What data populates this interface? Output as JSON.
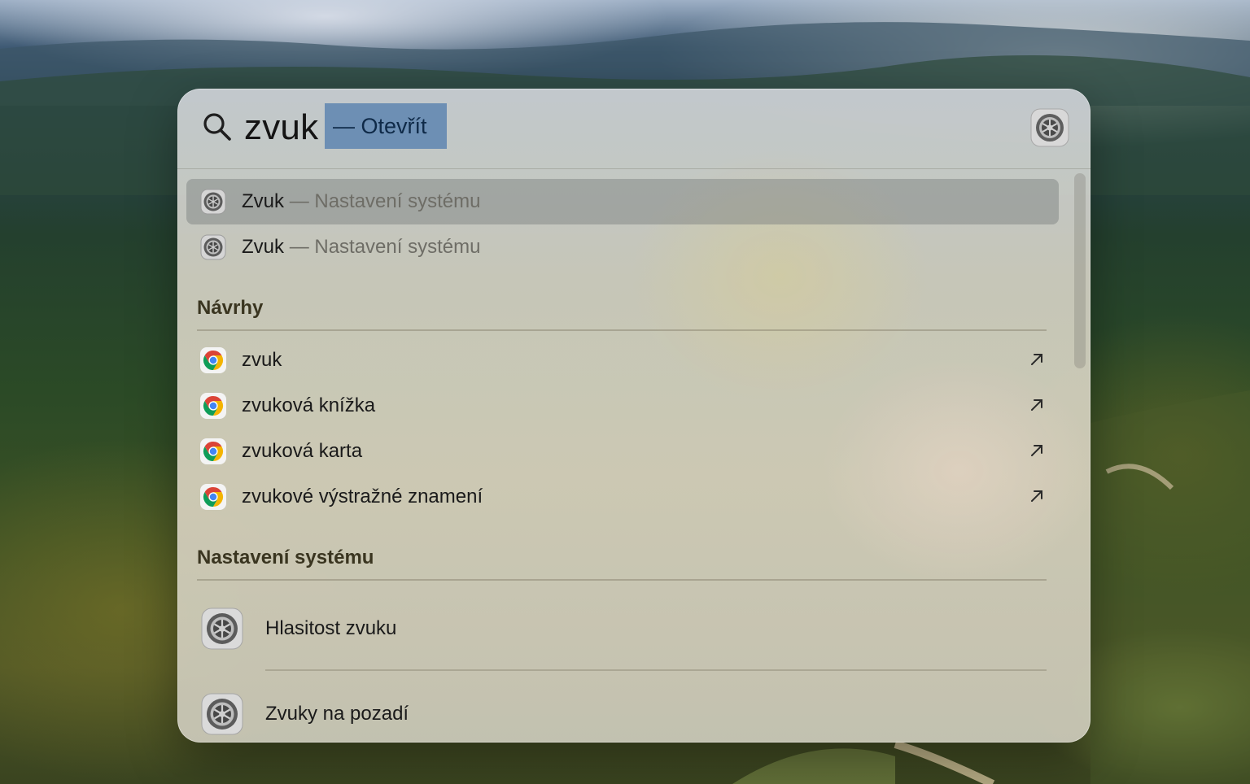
{
  "search": {
    "query": "zvuk",
    "completion": "— Otevřít",
    "search_icon": "magnifier-icon",
    "app_icon": "system-settings-gear-icon"
  },
  "top_hits": [
    {
      "title": "Zvuk",
      "subtitle": "— Nastavení systému",
      "icon": "system-settings-gear-icon",
      "selected": true
    },
    {
      "title": "Zvuk",
      "subtitle": "— Nastavení systému",
      "icon": "system-settings-gear-icon",
      "selected": false
    }
  ],
  "suggestions": {
    "header": "Návrhy",
    "items": [
      {
        "label": "zvuk",
        "icon": "chrome-icon",
        "action_icon": "arrow-up-right-icon"
      },
      {
        "label": "zvuková knížka",
        "icon": "chrome-icon",
        "action_icon": "arrow-up-right-icon"
      },
      {
        "label": "zvuková karta",
        "icon": "chrome-icon",
        "action_icon": "arrow-up-right-icon"
      },
      {
        "label": "zvukové výstražné znamení",
        "icon": "chrome-icon",
        "action_icon": "arrow-up-right-icon"
      }
    ]
  },
  "system_settings": {
    "header": "Nastavení systému",
    "items": [
      {
        "label": "Hlasitost zvuku",
        "icon": "system-settings-gear-icon"
      },
      {
        "label": "Zvuky na pozadí",
        "icon": "system-settings-gear-icon"
      }
    ]
  },
  "colors": {
    "selection": "#6d8fb4",
    "selected_row": "#8a8d88"
  }
}
